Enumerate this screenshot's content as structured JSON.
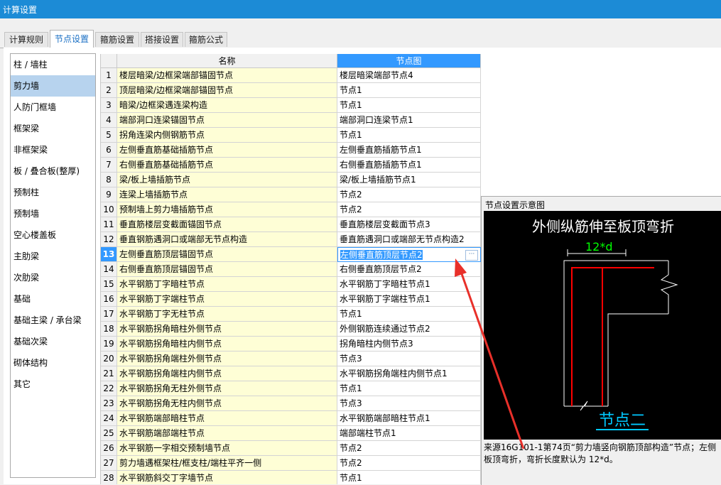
{
  "window": {
    "title": "计算设置"
  },
  "tabs": [
    {
      "label": "计算规则",
      "active": false
    },
    {
      "label": "节点设置",
      "active": true
    },
    {
      "label": "箍筋设置",
      "active": false
    },
    {
      "label": "搭接设置",
      "active": false
    },
    {
      "label": "箍筋公式",
      "active": false
    }
  ],
  "categories": [
    {
      "label": "柱 / 墙柱"
    },
    {
      "label": "剪力墙"
    },
    {
      "label": "人防门框墙"
    },
    {
      "label": "框架梁"
    },
    {
      "label": "非框架梁"
    },
    {
      "label": "板 / 叠合板(整厚)"
    },
    {
      "label": "预制柱"
    },
    {
      "label": "预制墙"
    },
    {
      "label": "空心楼盖板"
    },
    {
      "label": "主肋梁"
    },
    {
      "label": "次肋梁"
    },
    {
      "label": "基础"
    },
    {
      "label": "基础主梁 / 承台梁"
    },
    {
      "label": "基础次梁"
    },
    {
      "label": "砌体结构"
    },
    {
      "label": "其它"
    }
  ],
  "active_category": "剪力墙",
  "grid": {
    "headers": {
      "name": "名称",
      "node": "节点图"
    },
    "active_row": "13",
    "rows": [
      {
        "num": "1",
        "name": "楼层暗梁/边框梁端部锚固节点",
        "node": "楼层暗梁端部节点4"
      },
      {
        "num": "2",
        "name": "顶层暗梁/边框梁端部锚固节点",
        "node": "节点1"
      },
      {
        "num": "3",
        "name": "暗梁/边框梁遇连梁构造",
        "node": "节点1"
      },
      {
        "num": "4",
        "name": "端部洞口连梁锚固节点",
        "node": "端部洞口连梁节点1"
      },
      {
        "num": "5",
        "name": "拐角连梁内侧钢筋节点",
        "node": "节点1"
      },
      {
        "num": "6",
        "name": "左侧垂直筋基础插筋节点",
        "node": "左侧垂直筋插筋节点1"
      },
      {
        "num": "7",
        "name": "右侧垂直筋基础插筋节点",
        "node": "右侧垂直筋插筋节点1"
      },
      {
        "num": "8",
        "name": "梁/板上墙插筋节点",
        "node": "梁/板上墙插筋节点1"
      },
      {
        "num": "9",
        "name": "连梁上墙插筋节点",
        "node": "节点2"
      },
      {
        "num": "10",
        "name": "预制墙上剪力墙插筋节点",
        "node": "节点2"
      },
      {
        "num": "11",
        "name": "垂直筋楼层变截面锚固节点",
        "node": "垂直筋楼层变截面节点3"
      },
      {
        "num": "12",
        "name": "垂直钢筋遇洞口或端部无节点构造",
        "node": "垂直筋遇洞口或端部无节点构造2"
      },
      {
        "num": "13",
        "name": "左侧垂直筋顶层锚固节点",
        "node": "左侧垂直筋顶层节点2"
      },
      {
        "num": "14",
        "name": "右侧垂直筋顶层锚固节点",
        "node": "右侧垂直筋顶层节点2"
      },
      {
        "num": "15",
        "name": "水平钢筋丁字暗柱节点",
        "node": "水平钢筋丁字暗柱节点1"
      },
      {
        "num": "16",
        "name": "水平钢筋丁字端柱节点",
        "node": "水平钢筋丁字端柱节点1"
      },
      {
        "num": "17",
        "name": "水平钢筋丁字无柱节点",
        "node": "节点1"
      },
      {
        "num": "18",
        "name": "水平钢筋拐角暗柱外侧节点",
        "node": "外侧钢筋连续通过节点2"
      },
      {
        "num": "19",
        "name": "水平钢筋拐角暗柱内侧节点",
        "node": "拐角暗柱内侧节点3"
      },
      {
        "num": "20",
        "name": "水平钢筋拐角端柱外侧节点",
        "node": "节点3"
      },
      {
        "num": "21",
        "name": "水平钢筋拐角端柱内侧节点",
        "node": "水平钢筋拐角端柱内侧节点1"
      },
      {
        "num": "22",
        "name": "水平钢筋拐角无柱外侧节点",
        "node": "节点1"
      },
      {
        "num": "23",
        "name": "水平钢筋拐角无柱内侧节点",
        "node": "节点3"
      },
      {
        "num": "24",
        "name": "水平钢筋端部暗柱节点",
        "node": "水平钢筋端部暗柱节点1"
      },
      {
        "num": "25",
        "name": "水平钢筋端部端柱节点",
        "node": "端部端柱节点1"
      },
      {
        "num": "26",
        "name": "水平钢筋一字相交预制墙节点",
        "node": "节点2"
      },
      {
        "num": "27",
        "name": "剪力墙遇框架柱/框支柱/端柱平齐一侧",
        "node": "节点2"
      },
      {
        "num": "28",
        "name": "水平钢筋斜交丁字墙节点",
        "node": "节点1"
      }
    ]
  },
  "preview": {
    "title": "节点设置示意图",
    "caption": "外侧纵筋伸至板顶弯折",
    "dim_label": "12*d",
    "node_label": "节点二",
    "desc_line1": "来源16G101-1第74页“剪力墙竖向钢筋顶部构造”节点；左侧",
    "desc_line2": "板顶弯折，弯折长度默认为 12*d。",
    "colors": {
      "bg": "#000000",
      "bar": "#ff0000",
      "line": "#ffffff",
      "dim": "#00ff00",
      "label": "#00c8ff"
    }
  },
  "annotation": {
    "arrow_color": "#e8302a"
  }
}
